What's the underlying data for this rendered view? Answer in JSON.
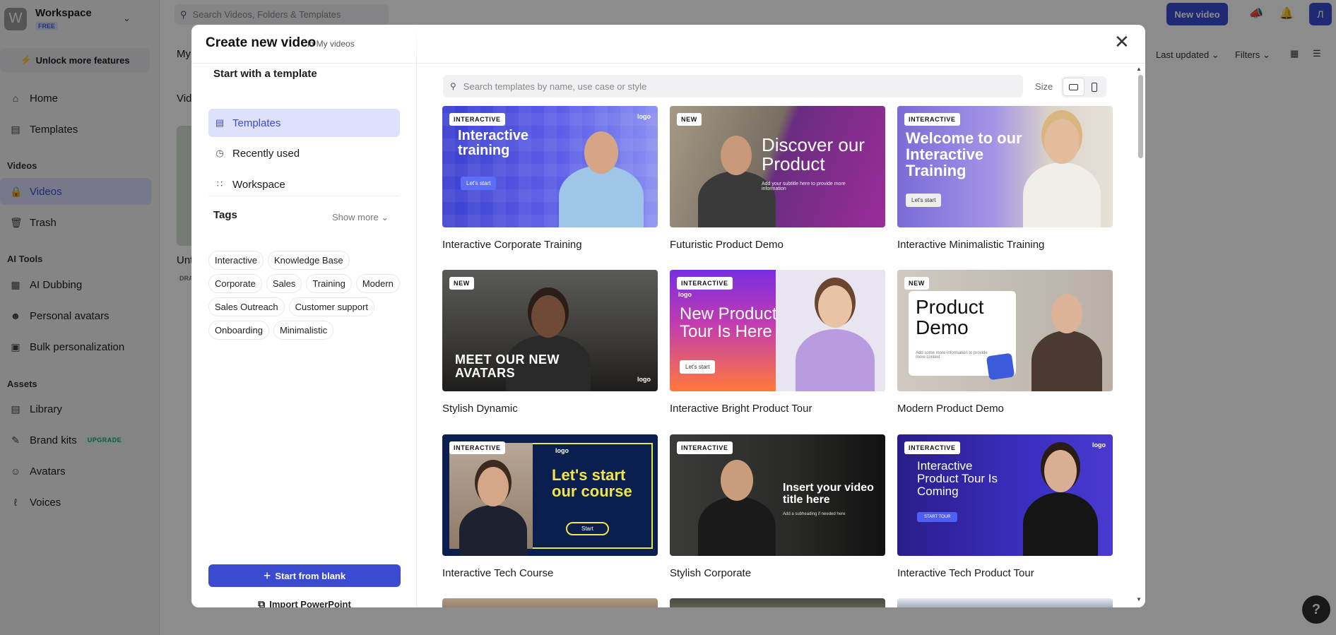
{
  "workspace": {
    "initial": "W",
    "name": "Workspace",
    "plan": "FREE"
  },
  "sidebar": {
    "unlock_label": "Unlock more features",
    "home": "Home",
    "templates": "Templates",
    "videos_section": "Videos",
    "videos": "Videos",
    "trash": "Trash",
    "ai_section": "AI Tools",
    "ai_dubbing": "AI Dubbing",
    "personal_avatars": "Personal avatars",
    "bulk": "Bulk personalization",
    "assets_section": "Assets",
    "library": "Library",
    "brand_kits": "Brand kits",
    "upgrade": "UPGRADE",
    "avatars": "Avatars",
    "voices": "Voices"
  },
  "topbar": {
    "search_placeholder": "Search Videos, Folders & Templates",
    "new_video": "New video",
    "user_initial": "Л"
  },
  "background": {
    "page_title_partial": "My",
    "videos_partial": "Vid",
    "card_title_partial": "Unt",
    "card_badge_partial": "DRA",
    "sort": "Last updated",
    "filters": "Filters"
  },
  "modal": {
    "title": "Create new video",
    "subtitle": "in My videos",
    "start_title": "Start with a template",
    "nav": [
      {
        "label": "Templates",
        "icon": "templates-icon"
      },
      {
        "label": "Recently used",
        "icon": "clock-icon"
      },
      {
        "label": "Workspace",
        "icon": "workspace-icon"
      }
    ],
    "tags_title": "Tags",
    "show_more": "Show more",
    "tags": [
      "Interactive",
      "Knowledge Base",
      "Corporate",
      "Sales",
      "Training",
      "Modern",
      "Sales Outreach",
      "Customer support",
      "Onboarding",
      "Minimalistic"
    ],
    "start_blank": "Start from blank",
    "import_ppt": "Import PowerPoint",
    "search_placeholder": "Search templates by name, use case or style",
    "size_label": "Size",
    "templates": [
      {
        "label": "Interactive Corporate Training",
        "badge": "INTERACTIVE",
        "headline": "Interactive training",
        "cta": "Let's start",
        "logo": "logo"
      },
      {
        "label": "Futuristic Product Demo",
        "badge": "NEW",
        "headline": "Discover our Product",
        "sub": "Add your subtitle here to provide more information"
      },
      {
        "label": "Interactive Minimalistic Training",
        "badge": "INTERACTIVE",
        "headline": "Welcome to our Interactive Training",
        "cta": "Let's start"
      },
      {
        "label": "Stylish Dynamic",
        "badge": "NEW",
        "headline": "MEET OUR NEW AVATARS",
        "logo": "logo"
      },
      {
        "label": "Interactive Bright Product Tour",
        "badge": "INTERACTIVE",
        "headline": "New Product Tour Is Here",
        "cta": "Let's start",
        "logo": "logo"
      },
      {
        "label": "Modern Product Demo",
        "badge": "NEW",
        "headline": "Product Demo",
        "sub": "Add some more information to provide more context"
      },
      {
        "label": "Interactive Tech Course",
        "badge": "INTERACTIVE",
        "headline": "Let's start our course",
        "cta": "Start",
        "logo": "logo"
      },
      {
        "label": "Stylish Corporate",
        "badge": "INTERACTIVE",
        "headline": "Insert your video title here",
        "sub": "Add a subheading if needed here"
      },
      {
        "label": "Interactive Tech Product Tour",
        "badge": "INTERACTIVE",
        "headline": "Interactive Product Tour Is Coming",
        "cta": "START TOUR",
        "logo": "logo"
      }
    ]
  }
}
